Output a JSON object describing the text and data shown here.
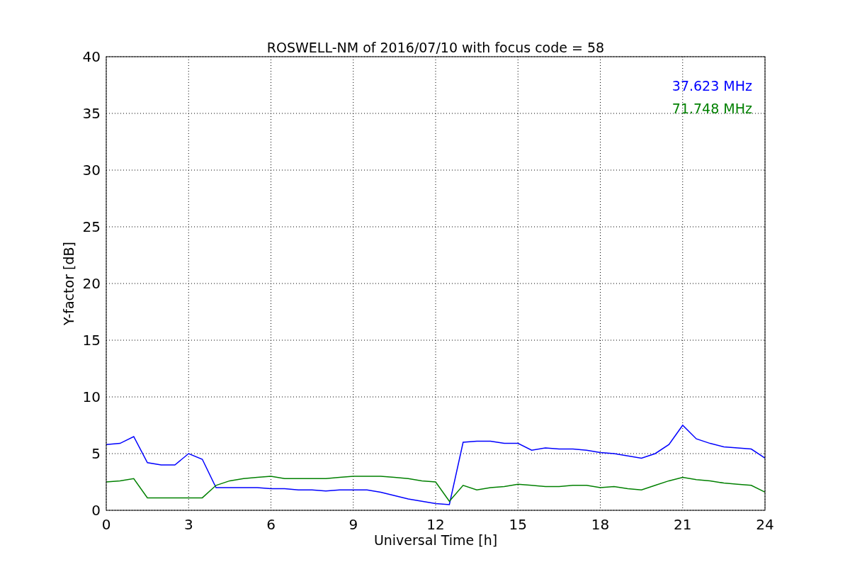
{
  "figure": {
    "chart_data": {
      "type": "line",
      "title": "ROSWELL-NM of 2016/07/10 with focus code = 58",
      "xlabel": "Universal Time [h]",
      "ylabel": "Y-factor [dB]",
      "x": [
        0,
        0.5,
        1,
        1.5,
        2,
        2.5,
        3,
        3.5,
        4,
        4.5,
        5,
        5.5,
        6,
        6.5,
        7,
        7.5,
        8,
        8.5,
        9,
        9.5,
        10,
        10.5,
        11,
        11.5,
        12,
        12.5,
        13,
        13.5,
        14,
        14.5,
        15,
        15.5,
        16,
        16.5,
        17,
        17.5,
        18,
        18.5,
        19,
        19.5,
        20,
        20.5,
        21,
        21.5,
        22,
        22.5,
        23,
        23.5,
        24
      ],
      "series": [
        {
          "name": "37.623 MHz",
          "color": "#0000ff",
          "values": [
            5.8,
            5.9,
            6.5,
            4.2,
            4.0,
            4.0,
            5.0,
            4.5,
            2.0,
            2.0,
            2.0,
            2.0,
            1.9,
            1.9,
            1.8,
            1.8,
            1.7,
            1.8,
            1.8,
            1.8,
            1.6,
            1.3,
            1.0,
            0.8,
            0.6,
            0.5,
            6.0,
            6.1,
            6.1,
            5.9,
            5.9,
            5.3,
            5.5,
            5.4,
            5.4,
            5.3,
            5.1,
            5.0,
            4.8,
            4.6,
            5.0,
            5.8,
            7.5,
            6.3,
            5.9,
            5.6,
            5.5,
            5.4,
            4.6
          ]
        },
        {
          "name": "71.748 MHz",
          "color": "#008000",
          "values": [
            2.5,
            2.6,
            2.8,
            1.1,
            1.1,
            1.1,
            1.1,
            1.1,
            2.2,
            2.6,
            2.8,
            2.9,
            3.0,
            2.8,
            2.8,
            2.8,
            2.8,
            2.9,
            3.0,
            3.0,
            3.0,
            2.9,
            2.8,
            2.6,
            2.5,
            0.8,
            2.2,
            1.8,
            2.0,
            2.1,
            2.3,
            2.2,
            2.1,
            2.1,
            2.2,
            2.2,
            2.0,
            2.1,
            1.9,
            1.8,
            2.2,
            2.6,
            2.9,
            2.7,
            2.6,
            2.4,
            2.3,
            2.2,
            1.6
          ]
        }
      ],
      "grid": true,
      "xlim": [
        0,
        24
      ],
      "ylim": [
        0,
        40
      ],
      "xticks": [
        0,
        3,
        6,
        9,
        12,
        15,
        18,
        21,
        24
      ],
      "yticks": [
        0,
        5,
        10,
        15,
        20,
        25,
        30,
        35,
        40
      ]
    }
  }
}
